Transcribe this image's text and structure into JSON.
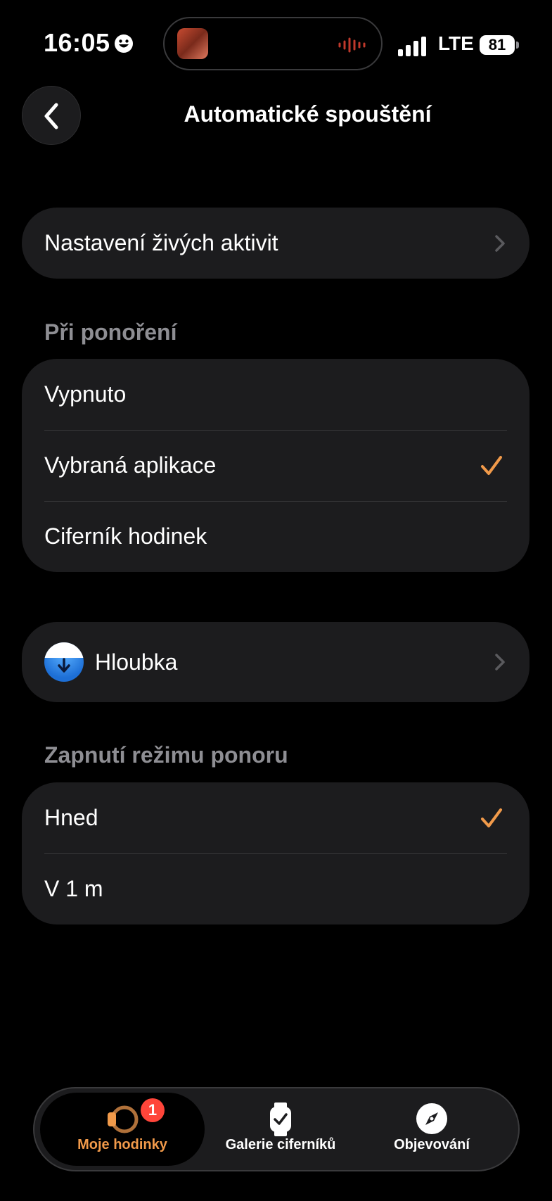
{
  "status_bar": {
    "time": "16:05",
    "network": "LTE",
    "battery": "81",
    "icons": [
      "smiley-icon",
      "now-playing-thumbnail",
      "audio-waveform-icon",
      "signal-icon",
      "battery-icon"
    ]
  },
  "nav": {
    "title": "Automatické spouštění",
    "back_icon": "chevron-left-icon"
  },
  "live_activities": {
    "label": "Nastavení živých aktivit"
  },
  "submersion": {
    "header": "Při ponoření",
    "options": [
      {
        "label": "Vypnuto",
        "selected": false
      },
      {
        "label": "Vybraná aplikace",
        "selected": true
      },
      {
        "label": "Ciferník hodinek",
        "selected": false
      }
    ]
  },
  "app": {
    "label": "Hloubka",
    "icon": "depth-gauge-icon"
  },
  "dive_mode": {
    "header": "Zapnutí režimu ponoru",
    "options": [
      {
        "label": "Hned",
        "selected": true
      },
      {
        "label": "V 1 m",
        "selected": false
      }
    ]
  },
  "tab_bar": {
    "tabs": [
      {
        "label": "Moje hodinky",
        "icon": "my-watch-icon",
        "badge": "1",
        "active": true
      },
      {
        "label": "Galerie ciferníků",
        "icon": "watch-face-gallery-icon",
        "active": false
      },
      {
        "label": "Objevování",
        "icon": "compass-icon",
        "active": false
      }
    ]
  },
  "colors": {
    "background": "#000000",
    "cell": "#1c1c1e",
    "accent": "#f19a4a",
    "secondary_text": "#8e8e93",
    "badge": "#ff453a"
  }
}
